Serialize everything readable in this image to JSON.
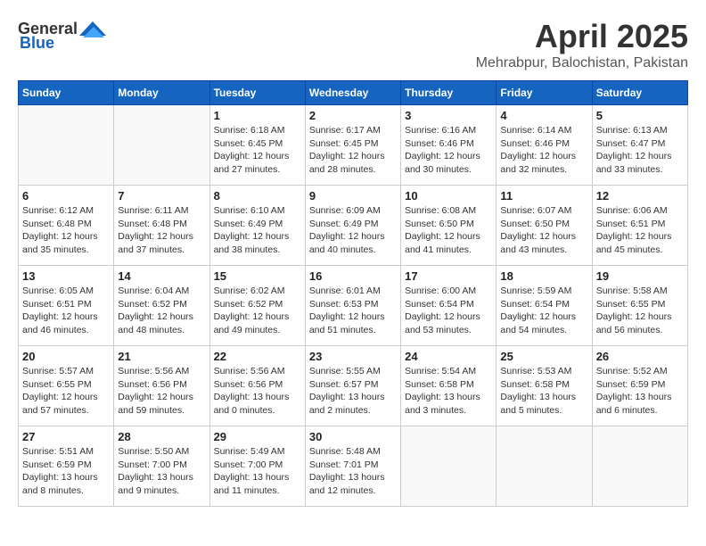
{
  "header": {
    "logo_general": "General",
    "logo_blue": "Blue",
    "month_title": "April 2025",
    "location": "Mehrabpur, Balochistan, Pakistan"
  },
  "weekdays": [
    "Sunday",
    "Monday",
    "Tuesday",
    "Wednesday",
    "Thursday",
    "Friday",
    "Saturday"
  ],
  "weeks": [
    [
      {
        "day": "",
        "info": ""
      },
      {
        "day": "",
        "info": ""
      },
      {
        "day": "1",
        "info": "Sunrise: 6:18 AM\nSunset: 6:45 PM\nDaylight: 12 hours\nand 27 minutes."
      },
      {
        "day": "2",
        "info": "Sunrise: 6:17 AM\nSunset: 6:45 PM\nDaylight: 12 hours\nand 28 minutes."
      },
      {
        "day": "3",
        "info": "Sunrise: 6:16 AM\nSunset: 6:46 PM\nDaylight: 12 hours\nand 30 minutes."
      },
      {
        "day": "4",
        "info": "Sunrise: 6:14 AM\nSunset: 6:46 PM\nDaylight: 12 hours\nand 32 minutes."
      },
      {
        "day": "5",
        "info": "Sunrise: 6:13 AM\nSunset: 6:47 PM\nDaylight: 12 hours\nand 33 minutes."
      }
    ],
    [
      {
        "day": "6",
        "info": "Sunrise: 6:12 AM\nSunset: 6:48 PM\nDaylight: 12 hours\nand 35 minutes."
      },
      {
        "day": "7",
        "info": "Sunrise: 6:11 AM\nSunset: 6:48 PM\nDaylight: 12 hours\nand 37 minutes."
      },
      {
        "day": "8",
        "info": "Sunrise: 6:10 AM\nSunset: 6:49 PM\nDaylight: 12 hours\nand 38 minutes."
      },
      {
        "day": "9",
        "info": "Sunrise: 6:09 AM\nSunset: 6:49 PM\nDaylight: 12 hours\nand 40 minutes."
      },
      {
        "day": "10",
        "info": "Sunrise: 6:08 AM\nSunset: 6:50 PM\nDaylight: 12 hours\nand 41 minutes."
      },
      {
        "day": "11",
        "info": "Sunrise: 6:07 AM\nSunset: 6:50 PM\nDaylight: 12 hours\nand 43 minutes."
      },
      {
        "day": "12",
        "info": "Sunrise: 6:06 AM\nSunset: 6:51 PM\nDaylight: 12 hours\nand 45 minutes."
      }
    ],
    [
      {
        "day": "13",
        "info": "Sunrise: 6:05 AM\nSunset: 6:51 PM\nDaylight: 12 hours\nand 46 minutes."
      },
      {
        "day": "14",
        "info": "Sunrise: 6:04 AM\nSunset: 6:52 PM\nDaylight: 12 hours\nand 48 minutes."
      },
      {
        "day": "15",
        "info": "Sunrise: 6:02 AM\nSunset: 6:52 PM\nDaylight: 12 hours\nand 49 minutes."
      },
      {
        "day": "16",
        "info": "Sunrise: 6:01 AM\nSunset: 6:53 PM\nDaylight: 12 hours\nand 51 minutes."
      },
      {
        "day": "17",
        "info": "Sunrise: 6:00 AM\nSunset: 6:54 PM\nDaylight: 12 hours\nand 53 minutes."
      },
      {
        "day": "18",
        "info": "Sunrise: 5:59 AM\nSunset: 6:54 PM\nDaylight: 12 hours\nand 54 minutes."
      },
      {
        "day": "19",
        "info": "Sunrise: 5:58 AM\nSunset: 6:55 PM\nDaylight: 12 hours\nand 56 minutes."
      }
    ],
    [
      {
        "day": "20",
        "info": "Sunrise: 5:57 AM\nSunset: 6:55 PM\nDaylight: 12 hours\nand 57 minutes."
      },
      {
        "day": "21",
        "info": "Sunrise: 5:56 AM\nSunset: 6:56 PM\nDaylight: 12 hours\nand 59 minutes."
      },
      {
        "day": "22",
        "info": "Sunrise: 5:56 AM\nSunset: 6:56 PM\nDaylight: 13 hours\nand 0 minutes."
      },
      {
        "day": "23",
        "info": "Sunrise: 5:55 AM\nSunset: 6:57 PM\nDaylight: 13 hours\nand 2 minutes."
      },
      {
        "day": "24",
        "info": "Sunrise: 5:54 AM\nSunset: 6:58 PM\nDaylight: 13 hours\nand 3 minutes."
      },
      {
        "day": "25",
        "info": "Sunrise: 5:53 AM\nSunset: 6:58 PM\nDaylight: 13 hours\nand 5 minutes."
      },
      {
        "day": "26",
        "info": "Sunrise: 5:52 AM\nSunset: 6:59 PM\nDaylight: 13 hours\nand 6 minutes."
      }
    ],
    [
      {
        "day": "27",
        "info": "Sunrise: 5:51 AM\nSunset: 6:59 PM\nDaylight: 13 hours\nand 8 minutes."
      },
      {
        "day": "28",
        "info": "Sunrise: 5:50 AM\nSunset: 7:00 PM\nDaylight: 13 hours\nand 9 minutes."
      },
      {
        "day": "29",
        "info": "Sunrise: 5:49 AM\nSunset: 7:00 PM\nDaylight: 13 hours\nand 11 minutes."
      },
      {
        "day": "30",
        "info": "Sunrise: 5:48 AM\nSunset: 7:01 PM\nDaylight: 13 hours\nand 12 minutes."
      },
      {
        "day": "",
        "info": ""
      },
      {
        "day": "",
        "info": ""
      },
      {
        "day": "",
        "info": ""
      }
    ]
  ]
}
